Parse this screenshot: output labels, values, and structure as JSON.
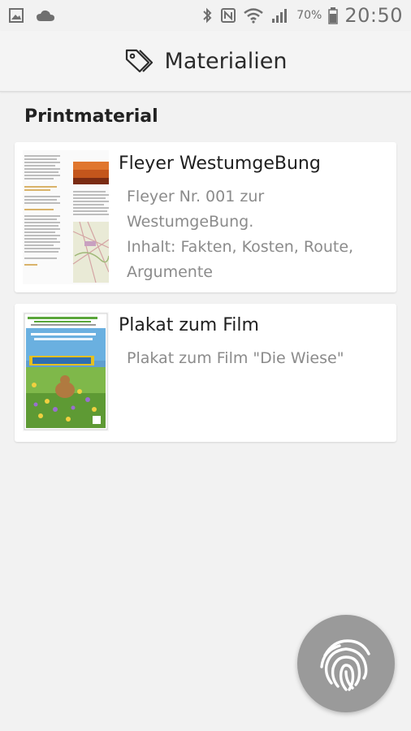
{
  "status": {
    "battery": "70%",
    "time": "20:50"
  },
  "appbar": {
    "title": "Materialien"
  },
  "section": {
    "title": "Printmaterial"
  },
  "items": [
    {
      "title": "Fleyer WestumgeBung",
      "desc": [
        "Fleyer Nr. 001 zur",
        "WestumgeBung.",
        "Inhalt: Fakten, Kosten, Route,",
        "Argumente"
      ]
    },
    {
      "title": "Plakat zum Film",
      "desc": [
        "Plakat zum Film \"Die Wiese\""
      ]
    }
  ],
  "fab": {
    "icon": "fingerprint-icon"
  }
}
